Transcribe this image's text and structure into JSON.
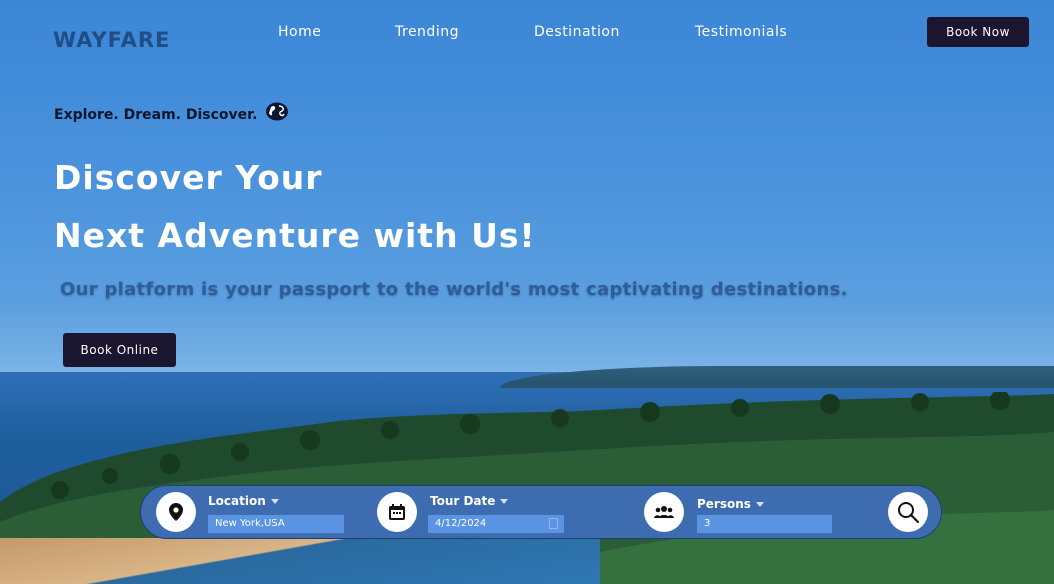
{
  "nav": {
    "logo": "WAYFARE",
    "links": [
      "Home",
      "Trending",
      "Destination",
      "Testimonials"
    ],
    "cta": "Book Now"
  },
  "hero": {
    "tagline": "Explore. Dream. Discover.",
    "title_line1": "Discover Your",
    "title_line2": "Next Adventure with Us!",
    "subtitle": "Our platform is your passport to the world's most captivating destinations.",
    "cta": "Book Online"
  },
  "search": {
    "location": {
      "label": "Location",
      "value": "New York,USA"
    },
    "date": {
      "label": "Tour Date",
      "value": "4/12/2024"
    },
    "persons": {
      "label": "Persons",
      "value": "3"
    }
  },
  "colors": {
    "primary_dark": "#1c1530",
    "search_bar": "#3d6cb0",
    "field_bg": "#5a94e3",
    "logo": "#1f4e87"
  },
  "icons": [
    "globe-icon",
    "location-pin-icon",
    "calendar-icon",
    "group-icon",
    "search-icon"
  ]
}
